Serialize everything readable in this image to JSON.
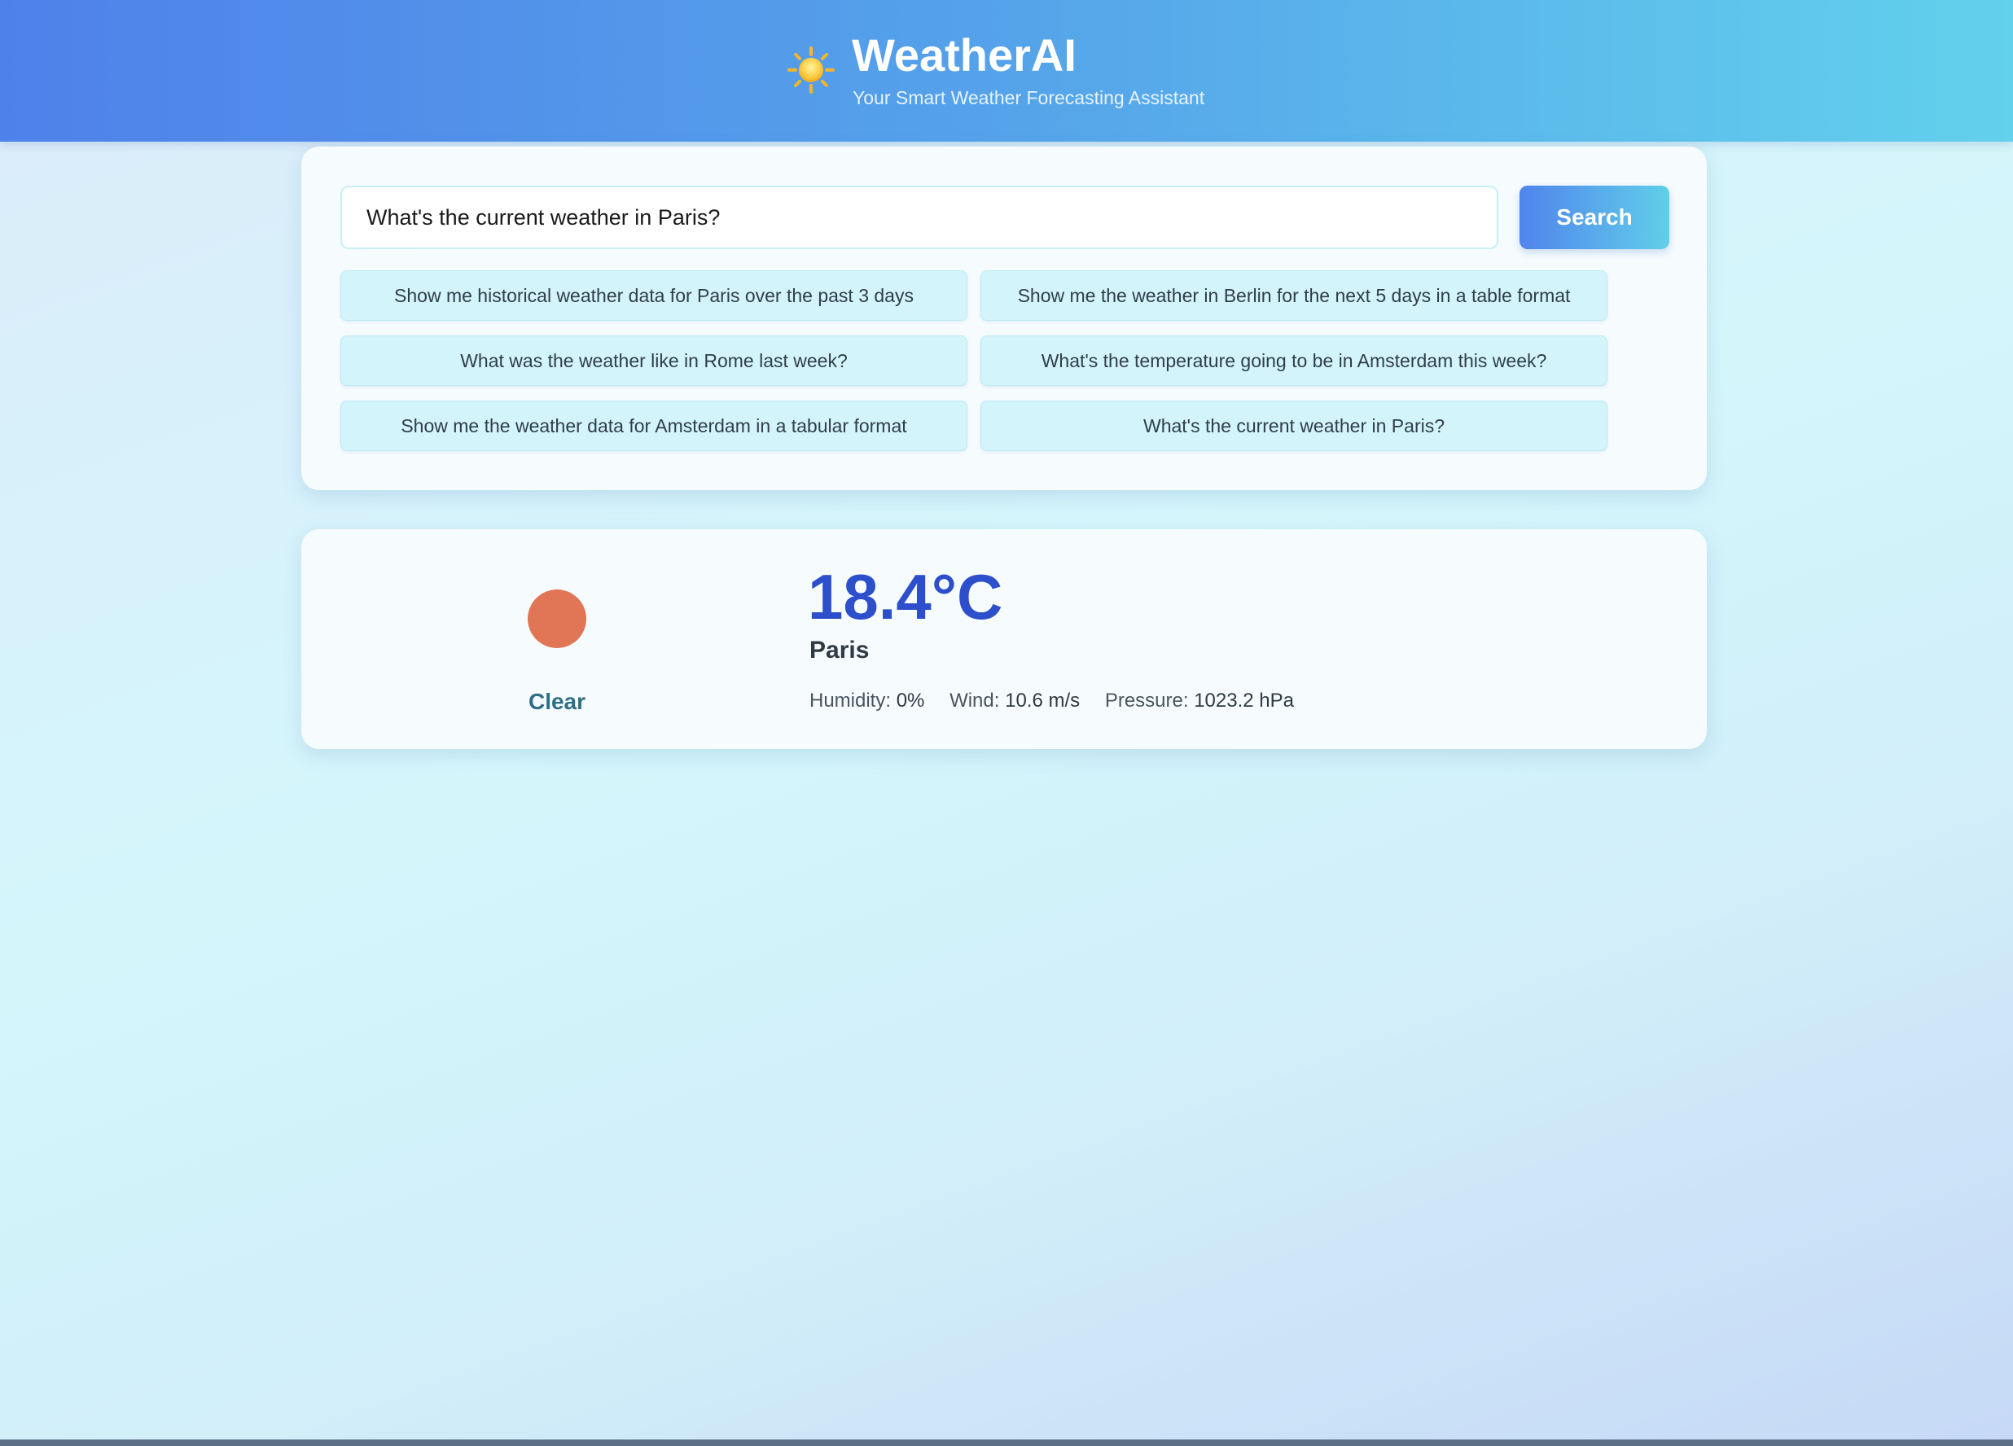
{
  "header": {
    "icon": "sun-icon",
    "title": "WeatherAI",
    "subtitle": "Your Smart Weather Forecasting Assistant",
    "gradient_colors": [
      "#4f81ea",
      "#62d1ec"
    ]
  },
  "search": {
    "value": "What's the current weather in Paris?",
    "button_label": "Search"
  },
  "suggestions": [
    "Show me historical weather data for Paris over the past 3 days",
    "Show me the weather in Berlin for the next 5 days in a table format",
    "What was the weather like in Rome last week?",
    "What's the temperature going to be in Amsterdam this week?",
    "Show me the weather data for Amsterdam in a tabular format",
    "What's the current weather in Paris?"
  ],
  "weather": {
    "icon": "condition-circle-icon",
    "icon_color": "#e07656",
    "condition": "Clear",
    "temperature": "18.4°C",
    "city": "Paris",
    "humidity_label": "Humidity:",
    "humidity_value": "0%",
    "wind_label": "Wind:",
    "wind_value": "10.6 m/s",
    "pressure_label": "Pressure:",
    "pressure_value": "1023.2 hPa",
    "temperature_color": "#2d4fcc"
  }
}
